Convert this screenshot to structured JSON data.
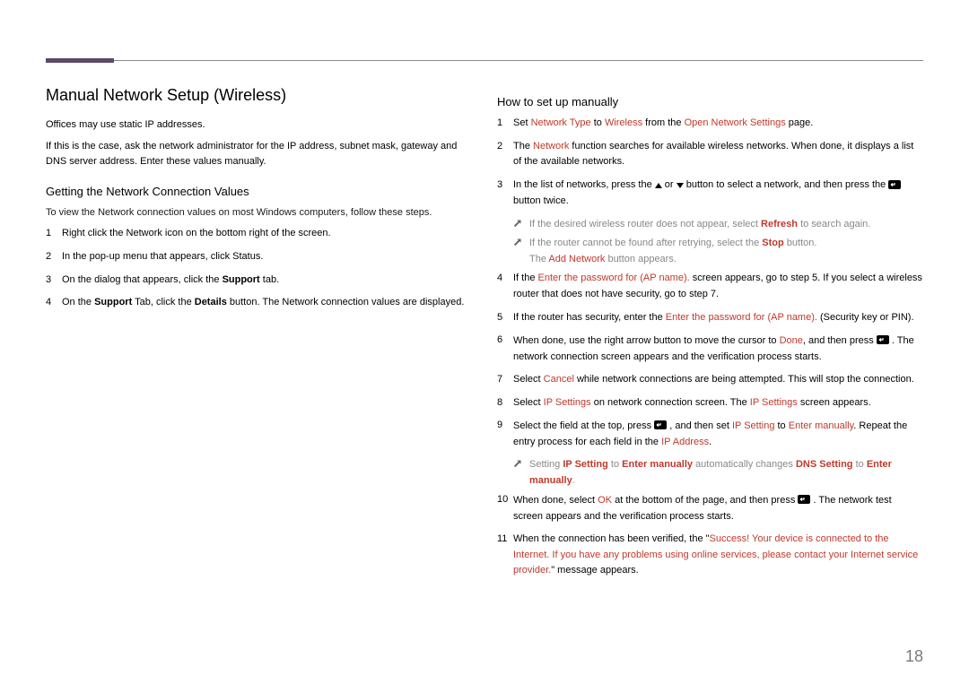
{
  "page_number": "18",
  "title": "Manual Network Setup (Wireless)",
  "intro1": "Offices may use static IP addresses.",
  "intro2": "If this is the case, ask the network administrator for the IP address, subnet mask, gateway and DNS server address. Enter these values manually.",
  "sec1": {
    "heading": "Getting the Network Connection Values",
    "lead": "To view the Network connection values on most Windows computers, follow these steps.",
    "s1": "Right click the Network icon on the bottom right of the screen.",
    "s2": "In the pop-up menu that appears, click Status.",
    "s3_a": "On the dialog that appears, click the ",
    "s3_b": "Support",
    "s3_c": " tab.",
    "s4_a": "On the ",
    "s4_b": "Support",
    "s4_c": " Tab, click the ",
    "s4_d": "Details",
    "s4_e": " button. The Network connection values are displayed."
  },
  "sec2": {
    "heading": "How to set up manually",
    "s1": {
      "a": "Set ",
      "b": "Network Type",
      "c": " to ",
      "d": "Wireless",
      "e": " from the ",
      "f": "Open Network Settings",
      "g": " page."
    },
    "s2": {
      "a": "The ",
      "b": "Network",
      "c": " function searches for available wireless networks. When done, it displays a list of the available networks."
    },
    "s3": {
      "a": "In the list of networks, press the ",
      "b": " or ",
      "c": " button to select a network, and then press the ",
      "d": " button twice."
    },
    "note3a": {
      "a": "If the desired wireless router does not appear, select ",
      "b": "Refresh",
      "c": " to search again."
    },
    "note3b": {
      "a": "If the router cannot be found after retrying, select the ",
      "b": "Stop",
      "c": " button."
    },
    "note3b2": {
      "a": "The ",
      "b": "Add Network",
      "c": " button appears."
    },
    "s4": {
      "a": "If the ",
      "b": "Enter the password for (AP name).",
      "c": " screen appears, go to step 5. If you select a wireless router that does not have security, go to step 7."
    },
    "s5": {
      "a": "If the router has security, enter the ",
      "b": "Enter the password for (AP name).",
      "c": " (Security key or PIN)."
    },
    "s6": {
      "a": "When done, use the right arrow button to move the cursor to ",
      "b": "Done",
      "c": ", and then press ",
      "d": ". The network connection screen appears and the verification process starts."
    },
    "s7": {
      "a": "Select ",
      "b": "Cancel",
      "c": " while network connections are being attempted. This will stop the connection."
    },
    "s8": {
      "a": "Select ",
      "b": "IP Settings",
      "c": " on network connection screen. The ",
      "d": "IP Settings",
      "e": " screen appears."
    },
    "s9": {
      "a": "Select the field at the top, press ",
      "b": ", and then set ",
      "c": "IP Setting",
      "d": " to ",
      "e": "Enter manually",
      "f": ". Repeat the entry process for each field in the ",
      "g": "IP Address",
      "h": "."
    },
    "note9": {
      "a": "Setting ",
      "b": "IP Setting",
      "c": " to ",
      "d": "Enter manually",
      "e": " automatically changes ",
      "f": "DNS Setting",
      "g": " to ",
      "h": "Enter manually",
      "i": "."
    },
    "s10": {
      "a": "When done, select ",
      "b": "OK",
      "c": " at the bottom of the page, and then press ",
      "d": ". The network test screen appears and the verification process starts."
    },
    "s11": {
      "a": "When the connection has been verified, the \"",
      "b": "Success! Your device is connected to the Internet. If you have any problems using online services, please contact your Internet service provider.",
      "c": "\" message appears."
    }
  }
}
